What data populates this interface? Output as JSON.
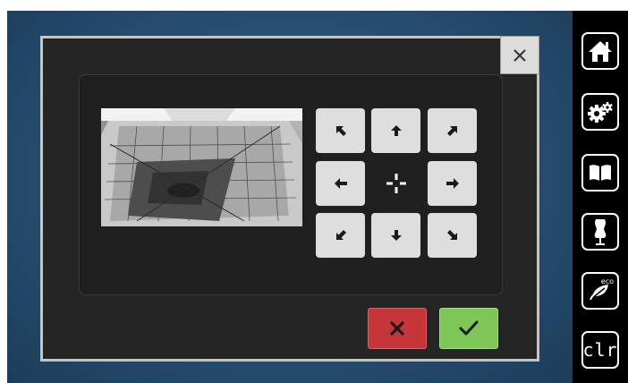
{
  "sidebar": {
    "items": [
      {
        "icon": "home-icon"
      },
      {
        "icon": "settings-gears-icon"
      },
      {
        "icon": "guide-book-icon"
      },
      {
        "icon": "dress-form-icon"
      },
      {
        "icon": "eco-leaf-icon",
        "label": "eco"
      },
      {
        "icon": "clear-icon",
        "label": "clr"
      }
    ]
  },
  "dialog": {
    "close_icon": "close-icon",
    "camera_icon": "embroidery-hoop-camera-view",
    "move_pad": {
      "buttons": [
        {
          "direction": "up-left",
          "icon": "arrow-up-left-icon"
        },
        {
          "direction": "up",
          "icon": "arrow-up-icon"
        },
        {
          "direction": "up-right",
          "icon": "arrow-up-right-icon"
        },
        {
          "direction": "left",
          "icon": "arrow-left-icon"
        },
        {
          "direction": "right",
          "icon": "arrow-right-icon"
        },
        {
          "direction": "down-left",
          "icon": "arrow-down-left-icon"
        },
        {
          "direction": "down",
          "icon": "arrow-down-icon"
        },
        {
          "direction": "down-right",
          "icon": "arrow-down-right-icon"
        }
      ],
      "center_icon": "center-crosshair-icon"
    },
    "cancel_icon": "cancel-x-icon",
    "confirm_icon": "confirm-check-icon"
  },
  "colors": {
    "cancel": "#c6353a",
    "confirm": "#7ec655",
    "dialog_bg": "#252525",
    "button_bg": "#dedede"
  }
}
